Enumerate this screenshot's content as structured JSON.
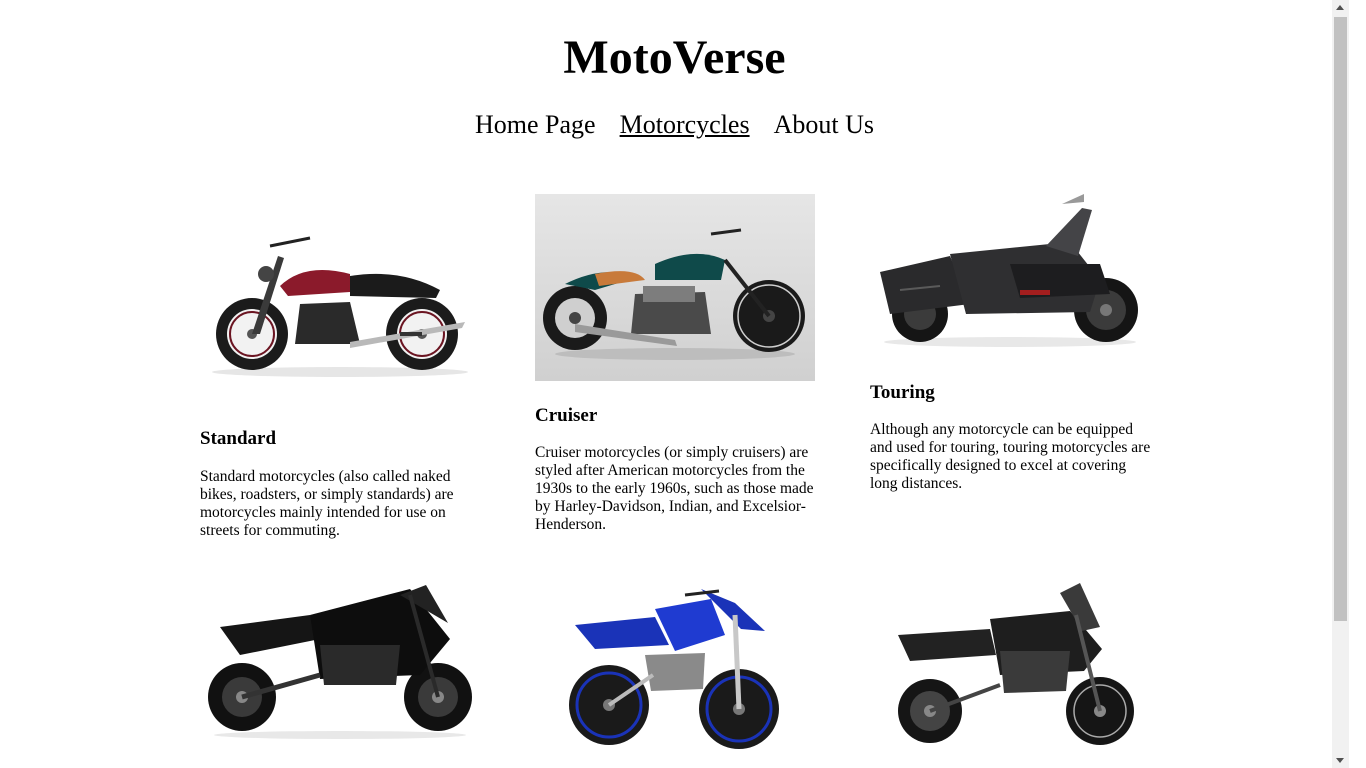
{
  "site": {
    "title": "MotoVerse"
  },
  "nav": {
    "items": [
      {
        "label": "Home Page",
        "active": false
      },
      {
        "label": "Motorcycles",
        "active": true
      },
      {
        "label": "About Us",
        "active": false
      }
    ]
  },
  "cards": [
    {
      "title": "Standard",
      "description": "Standard motorcycles (also called naked bikes, roadsters, or simply standards) are motorcycles mainly intended for use on streets for commuting.",
      "image": "standard-motorcycle-image",
      "colors": {
        "body": "#8b1a2b",
        "frame": "#1b1b1b"
      }
    },
    {
      "title": "Cruiser",
      "description": "Cruiser motorcycles (or simply cruisers) are styled after American motorcycles from the 1930s to the early 1960s, such as those made by Harley-Davidson, Indian, and Excelsior-Henderson.",
      "image": "cruiser-motorcycle-image",
      "colors": {
        "body": "#0f4a4a",
        "frame": "#1a1a1a"
      }
    },
    {
      "title": "Touring",
      "description": "Although any motorcycle can be equipped and used for touring, touring motorcycles are specifically designed to excel at covering long distances.",
      "image": "touring-motorcycle-image",
      "colors": {
        "body": "#2a2a2c",
        "frame": "#111111"
      }
    },
    {
      "title": "",
      "description": "",
      "image": "sport-motorcycle-image",
      "colors": {
        "body": "#111111",
        "frame": "#0a0a0a"
      }
    },
    {
      "title": "",
      "description": "",
      "image": "dirt-bike-image",
      "colors": {
        "body": "#1a33b8",
        "frame": "#111111"
      }
    },
    {
      "title": "",
      "description": "",
      "image": "dual-sport-motorcycle-image",
      "colors": {
        "body": "#222222",
        "frame": "#111111"
      }
    }
  ]
}
